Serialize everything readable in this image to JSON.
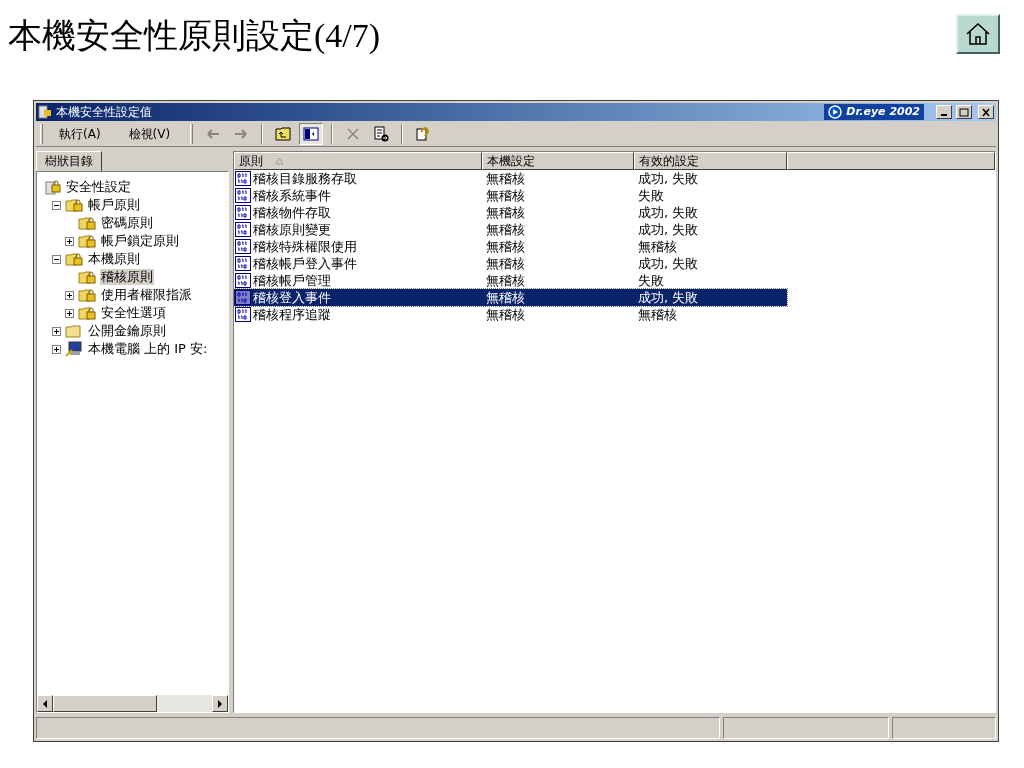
{
  "slide": {
    "title": "本機安全性原則設定(4/7)"
  },
  "window": {
    "title": "本機安全性設定值",
    "badge": "Dr.eye 2002"
  },
  "menu": [
    {
      "label": "執行(A)"
    },
    {
      "label": "檢視(V)"
    }
  ],
  "toolbar": [
    {
      "kind": "button",
      "disabled": true
    },
    {
      "kind": "button",
      "disabled": true
    },
    {
      "kind": "separator"
    },
    {
      "kind": "button",
      "disabled": false
    },
    {
      "kind": "button",
      "disabled": false,
      "pressed": true
    },
    {
      "kind": "separator"
    },
    {
      "kind": "button",
      "disabled": true
    },
    {
      "kind": "button",
      "disabled": false
    },
    {
      "kind": "separator"
    },
    {
      "kind": "button",
      "disabled": false
    }
  ],
  "tree_tab": {
    "label": "樹狀目錄"
  },
  "tree": [
    {
      "label": "安全性設定",
      "kind": "root",
      "selected": false,
      "children": [
        {
          "label": "帳戶原則",
          "kind": "branch",
          "expanded": true,
          "selected": false,
          "children": [
            {
              "label": "密碼原則",
              "kind": "leaf",
              "selected": false
            },
            {
              "label": "帳戶鎖定原則",
              "kind": "branch",
              "expanded": false,
              "selected": false
            }
          ]
        },
        {
          "label": "本機原則",
          "kind": "branch",
          "expanded": true,
          "selected": false,
          "children": [
            {
              "label": "稽核原則",
              "kind": "leaf",
              "selected": true
            },
            {
              "label": "使用者權限指派",
              "kind": "branch",
              "expanded": false,
              "selected": false
            },
            {
              "label": "安全性選項",
              "kind": "branch",
              "expanded": false,
              "selected": false
            }
          ]
        },
        {
          "label": "公開金鑰原則",
          "kind": "branch",
          "expanded": false,
          "selected": false
        },
        {
          "label": "本機電腦 上的 IP 安:",
          "kind": "branch",
          "expanded": false,
          "selected": false
        }
      ]
    }
  ],
  "table": {
    "columns": [
      {
        "label": "原則",
        "sorted": true
      },
      {
        "label": "本機設定",
        "sorted": false
      },
      {
        "label": "有效的設定",
        "sorted": false
      }
    ],
    "rows": [
      {
        "policy": "稽核目錄服務存取",
        "local": "無稽核",
        "effective": "成功, 失敗",
        "selected": false
      },
      {
        "policy": "稽核系統事件",
        "local": "無稽核",
        "effective": "失敗",
        "selected": false
      },
      {
        "policy": "稽核物件存取",
        "local": "無稽核",
        "effective": "成功, 失敗",
        "selected": false
      },
      {
        "policy": "稽核原則變更",
        "local": "無稽核",
        "effective": "成功, 失敗",
        "selected": false
      },
      {
        "policy": "稽核特殊權限使用",
        "local": "無稽核",
        "effective": "無稽核",
        "selected": false
      },
      {
        "policy": "稽核帳戶登入事件",
        "local": "無稽核",
        "effective": "成功, 失敗",
        "selected": false
      },
      {
        "policy": "稽核帳戶管理",
        "local": "無稽核",
        "effective": "失敗",
        "selected": false
      },
      {
        "policy": "稽核登入事件",
        "local": "無稽核",
        "effective": "成功, 失敗",
        "selected": true
      },
      {
        "policy": "稽核程序追蹤",
        "local": "無稽核",
        "effective": "無稽核",
        "selected": false
      }
    ]
  }
}
